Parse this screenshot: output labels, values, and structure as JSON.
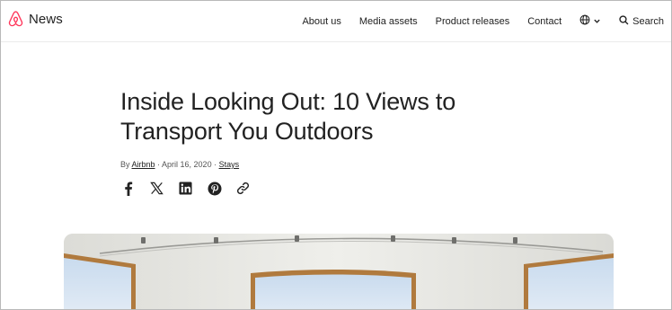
{
  "header": {
    "brand_label": "News",
    "brand_color": "#FF385C",
    "nav": [
      {
        "label": "About us"
      },
      {
        "label": "Media assets"
      },
      {
        "label": "Product releases"
      },
      {
        "label": "Contact"
      }
    ],
    "language_icon": "globe-icon",
    "search_label": "Search"
  },
  "article": {
    "title": "Inside Looking Out: 10 Views to Transport You Outdoors",
    "byline": {
      "by": "By ",
      "author": "Airbnb",
      "date": " · April 16, 2020 · ",
      "category": "Stays"
    },
    "share_icons": [
      "facebook-icon",
      "x-icon",
      "linkedin-icon",
      "pinterest-icon",
      "link-icon"
    ]
  }
}
